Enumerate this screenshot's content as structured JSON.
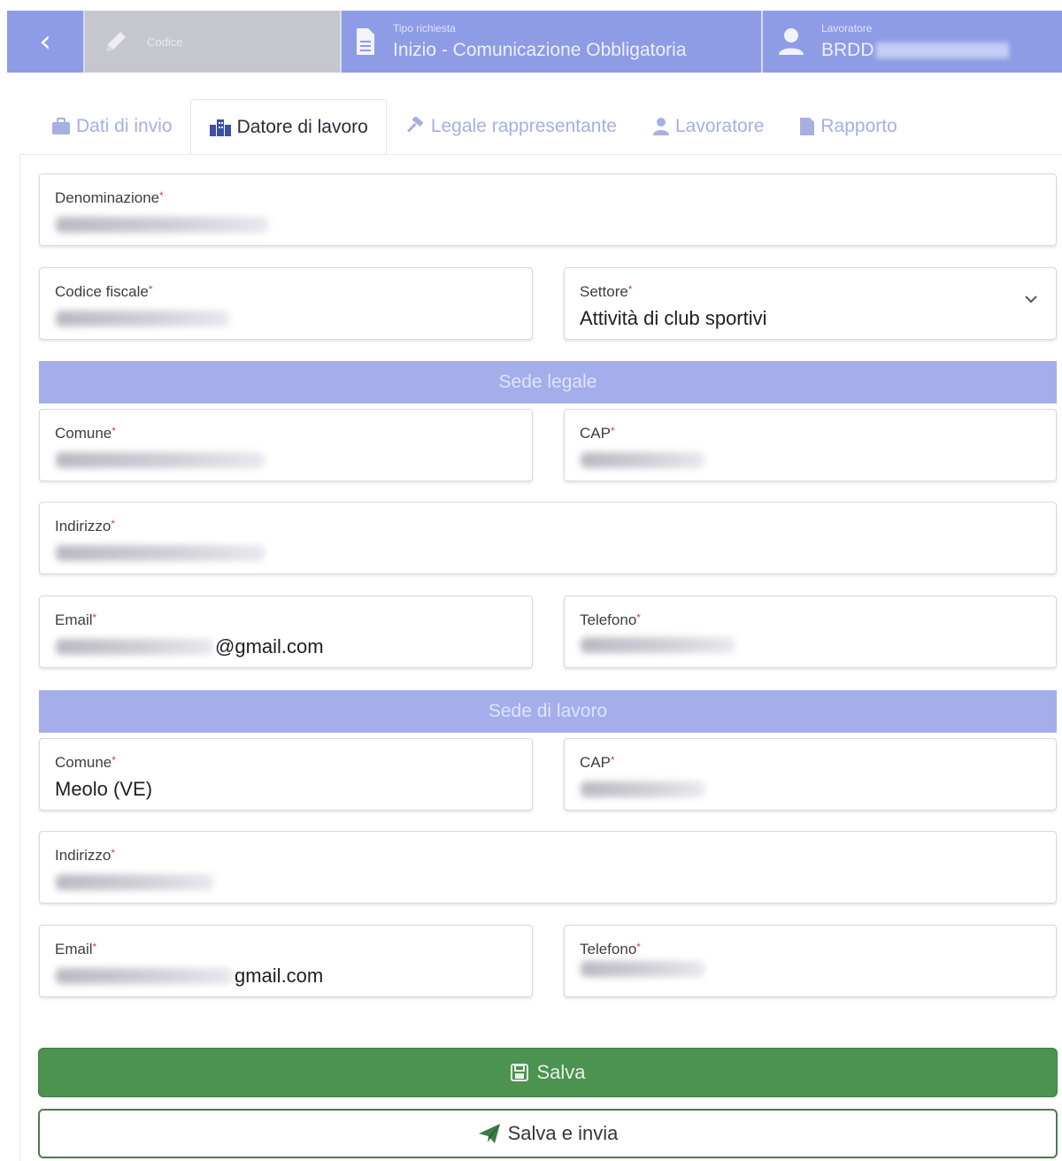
{
  "header": {
    "codice_label": "Codice",
    "tipo_label": "Tipo richiesta",
    "tipo_value": "Inizio - Comunicazione Obbligatoria",
    "lavoratore_label": "Lavoratore",
    "lavoratore_value": "BRDD"
  },
  "tabs": [
    {
      "label": "Dati di invio",
      "icon": "briefcase-icon"
    },
    {
      "label": "Datore di lavoro",
      "icon": "building-icon"
    },
    {
      "label": "Legale rappresentante",
      "icon": "gavel-icon"
    },
    {
      "label": "Lavoratore",
      "icon": "user-icon"
    },
    {
      "label": "Rapporto",
      "icon": "document-icon"
    }
  ],
  "form": {
    "denominazione_label": "Denominazione",
    "codice_fiscale_label": "Codice fiscale",
    "settore_label": "Settore",
    "settore_value": "Attività di club sportivi"
  },
  "sede_legale": {
    "title": "Sede legale",
    "comune_label": "Comune",
    "cap_label": "CAP",
    "indirizzo_label": "Indirizzo",
    "email_label": "Email",
    "email_value": "@gmail.com",
    "telefono_label": "Telefono"
  },
  "sede_lavoro": {
    "title": "Sede di lavoro",
    "comune_label": "Comune",
    "comune_value": "Meolo (VE)",
    "cap_label": "CAP",
    "indirizzo_label": "Indirizzo",
    "email_label": "Email",
    "email_value": "gmail.com",
    "telefono_label": "Telefono"
  },
  "required_mark": "*",
  "buttons": {
    "salva": "Salva",
    "salva_invia": "Salva e invia"
  },
  "colors": {
    "header_blue": "#8e9ce6",
    "section_blue": "#a3aeea",
    "save_green": "#4c9250",
    "required_red": "#d04545"
  }
}
